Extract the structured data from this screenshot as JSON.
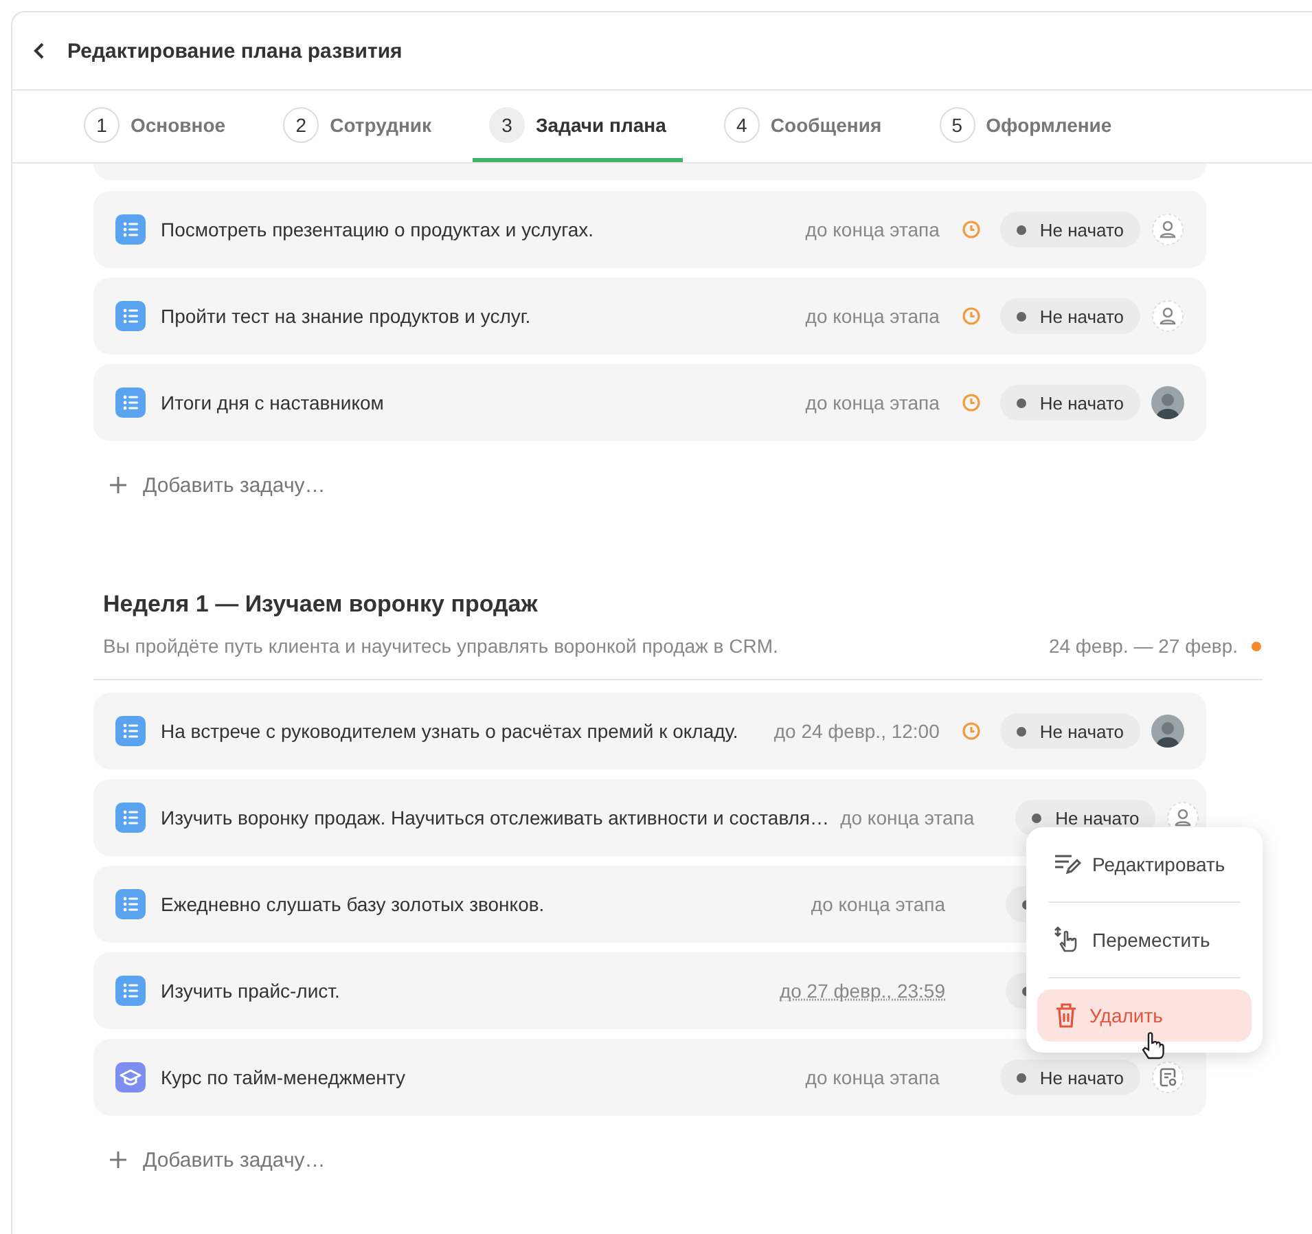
{
  "header": {
    "title": "Редактирование плана развития"
  },
  "tabs": [
    {
      "number": "1",
      "label": "Основное",
      "selected": false
    },
    {
      "number": "2",
      "label": "Сотрудник",
      "selected": false
    },
    {
      "number": "3",
      "label": "Задачи плана",
      "selected": true
    },
    {
      "number": "4",
      "label": "Сообщения",
      "selected": false
    },
    {
      "number": "5",
      "label": "Оформление",
      "selected": false
    }
  ],
  "sections": [
    {
      "tasks": [
        {
          "kind": "task",
          "title": "Посмотреть презентацию о продуктах и услугах.",
          "deadline": "до конца этапа",
          "deadline_underlined": false,
          "clock": true,
          "status": "Не начато",
          "assignee": {
            "kind": "empty"
          }
        },
        {
          "kind": "task",
          "title": "Пройти тест на знание продуктов и услуг.",
          "deadline": "до конца этапа",
          "deadline_underlined": false,
          "clock": true,
          "status": "Не начато",
          "assignee": {
            "kind": "empty"
          }
        },
        {
          "kind": "task",
          "title": "Итоги дня с наставником",
          "deadline": "до конца этапа",
          "deadline_underlined": false,
          "clock": true,
          "status": "Не начато",
          "assignee": {
            "kind": "avatar"
          }
        }
      ],
      "add_label": "Добавить задачу…"
    },
    {
      "title": "Неделя 1 — Изучаем воронку продаж",
      "description": "Вы пройдёте путь клиента и научитесь управлять воронкой продаж в CRM.",
      "dates": "24 февр. — 27 февр.",
      "dot": {
        "color": "#f5882a"
      },
      "tasks": [
        {
          "kind": "task",
          "title": "На встрече с руководителем узнать о расчётах премий к окладу.",
          "deadline": "до 24 февр., 12:00",
          "deadline_underlined": false,
          "clock": true,
          "status": "Не начато",
          "assignee": {
            "kind": "avatar"
          }
        },
        {
          "kind": "task",
          "title": "Изучить воронку продаж. Научиться отслеживать активности и составля…",
          "deadline": "до конца этапа",
          "deadline_underlined": false,
          "clock": false,
          "status": "Не начато",
          "assignee": {
            "kind": "empty"
          }
        },
        {
          "kind": "task",
          "title": "Ежедневно слушать базу золотых звонков.",
          "deadline": "до конца этапа",
          "deadline_underlined": false,
          "clock": false
        },
        {
          "kind": "task",
          "title": "Изучить прайс-лист.",
          "deadline": "до 27 февр., 23:59",
          "deadline_underlined": true,
          "clock": false
        },
        {
          "kind": "course",
          "title": "Курс по тайм-менеджменту",
          "deadline": "до конца этапа",
          "deadline_underlined": false,
          "clock": false,
          "status": "Не начато",
          "assignee": {
            "kind": "course"
          }
        }
      ],
      "add_label": "Добавить задачу…"
    }
  ],
  "context_menu": {
    "items": [
      {
        "kind": "edit",
        "label": "Редактировать",
        "selected": false
      },
      {
        "kind": "move",
        "label": "Переместить",
        "selected": false
      },
      {
        "kind": "delete",
        "label": "Удалить",
        "selected": true
      }
    ]
  }
}
